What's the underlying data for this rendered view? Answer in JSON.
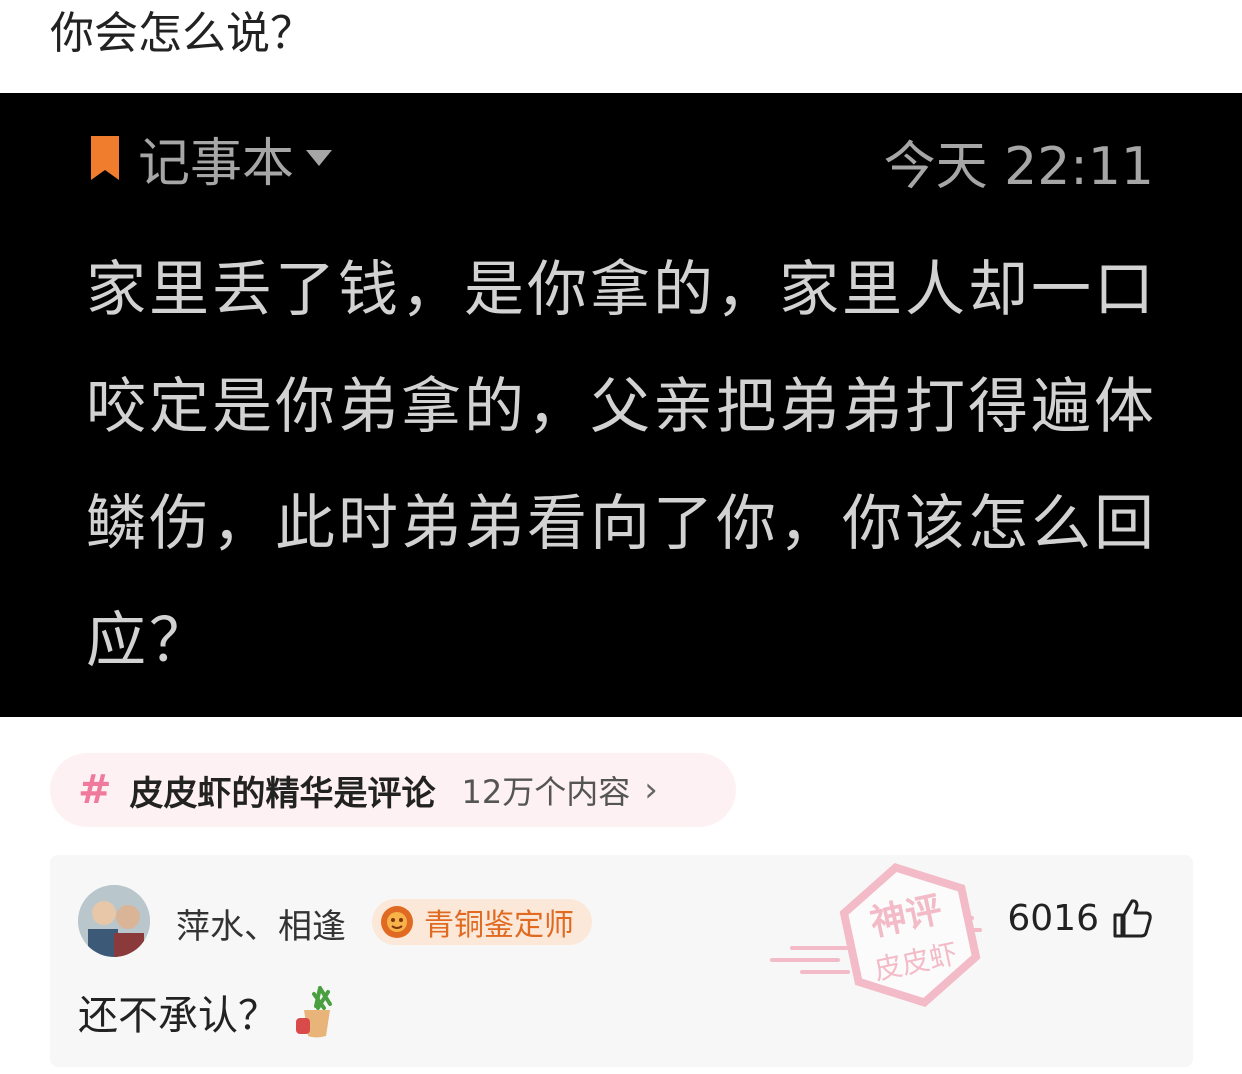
{
  "post": {
    "title": "你会怎么说？"
  },
  "note": {
    "app_label": "记事本",
    "time": "今天 22:11",
    "lines": [
      "家里丢了钱，是你拿的，家里人却一口",
      "咬定是你弟拿的，父亲把弟弟打得遍体",
      "鳞伤，此时弟弟看向了你，你该怎么回",
      "应？"
    ],
    "colors": {
      "bookmark": "#ef7d2d",
      "text": "#d2d2d2",
      "muted": "#a6a6a6"
    }
  },
  "topic": {
    "name": "皮皮虾的精华是评论",
    "count": "12万个内容",
    "icon": "hash-icon",
    "colors": {
      "hash": "#f07a9c",
      "background": "#fdf1f3"
    }
  },
  "comment": {
    "username": "萍水、相逢",
    "badge": "青铜鉴定师",
    "likes": "6016",
    "text": "还不承认？",
    "stamp_text": [
      "神评",
      "皮皮虾"
    ],
    "icons": [
      "avatar",
      "badge-icon",
      "thumb-up-icon",
      "emoji-icon",
      "stamp"
    ]
  }
}
